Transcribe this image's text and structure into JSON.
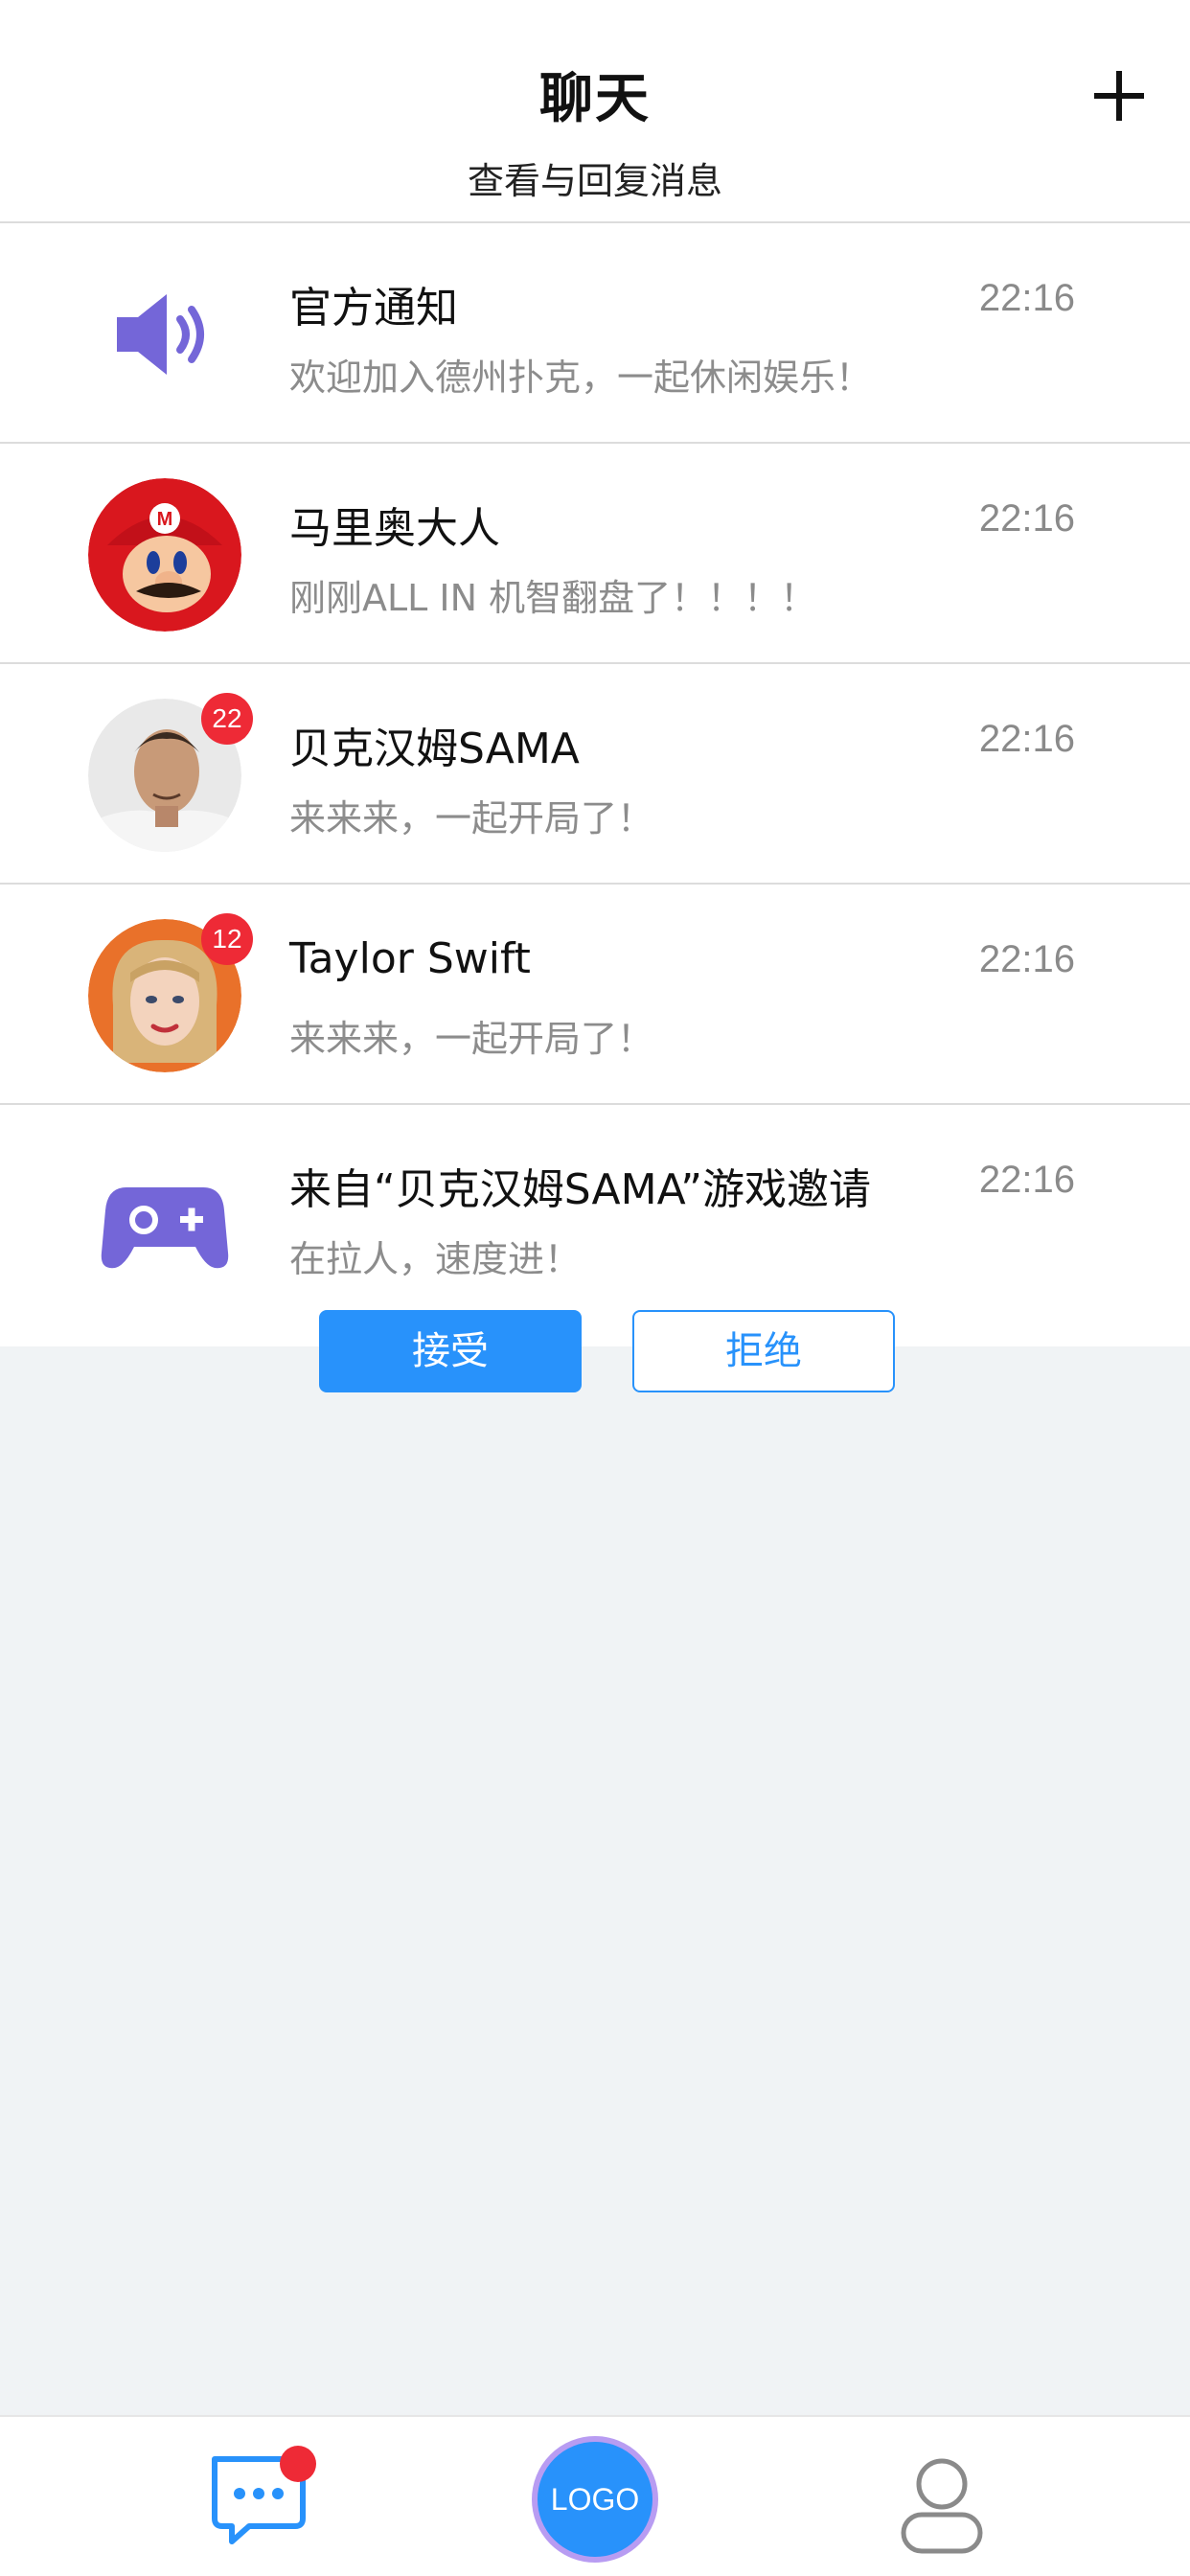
{
  "header": {
    "title": "聊天",
    "subtitle": "查看与回复消息"
  },
  "conversations": [
    {
      "name": "官方通知",
      "time": "22:16",
      "message": "欢迎加入德州扑克，一起休闲娱乐！",
      "icon": "speaker-icon"
    },
    {
      "name": "马里奥大人",
      "time": "22:16",
      "message": "刚刚ALL IN 机智翻盘了！！！！"
    },
    {
      "name": "贝克汉姆SAMA",
      "time": "22:16",
      "message": "来来来，一起开局了！",
      "badge": "22"
    },
    {
      "name": "Taylor Swift",
      "time": "22:16",
      "message": "来来来，一起开局了！",
      "badge": "12"
    },
    {
      "name": "来自“贝克汉姆SAMA”游戏邀请",
      "time": "22:16",
      "message": "在拉人，速度进！",
      "icon": "gamepad-icon"
    }
  ],
  "invite_actions": {
    "accept": "接受",
    "reject": "拒绝"
  },
  "tabbar": {
    "logo": "LOGO",
    "chat_icon": "chat-bubble-icon",
    "me_icon": "person-icon"
  },
  "colors": {
    "accent": "#2892fb",
    "badge": "#ee2a36",
    "icon_purple": "#7466d8"
  }
}
